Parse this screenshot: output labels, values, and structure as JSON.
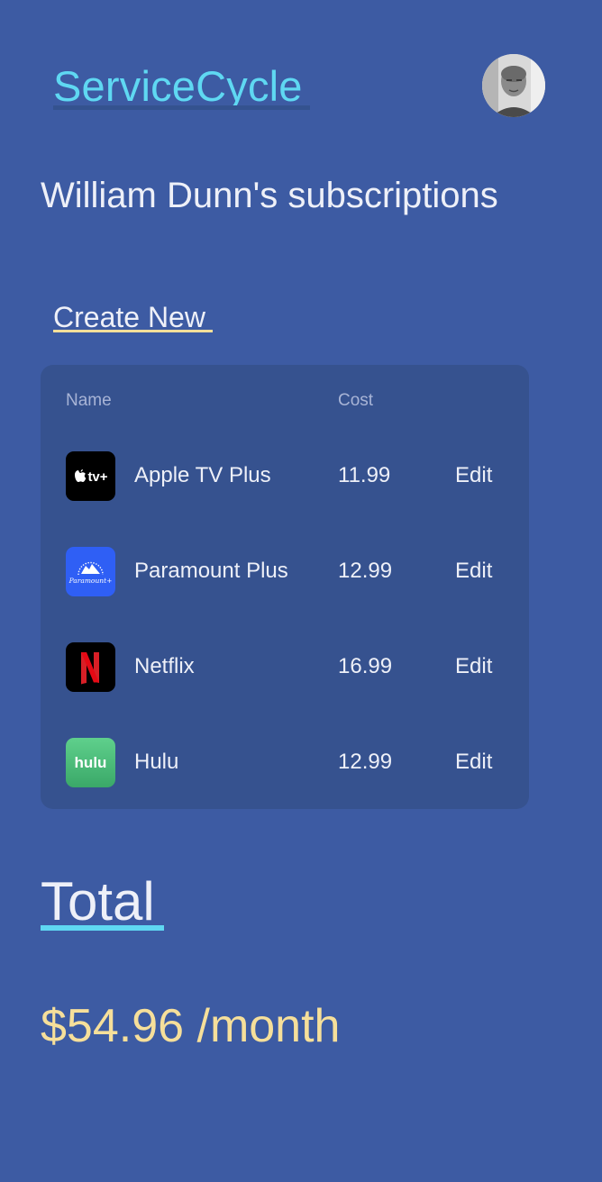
{
  "app": {
    "brand": "ServiceCycle",
    "brand_color": "#5fd8f2"
  },
  "header": {
    "avatar_icon": "user-avatar"
  },
  "page": {
    "title": "William Dunn's subscriptions",
    "create_new_label": "Create New"
  },
  "table": {
    "headers": {
      "name": "Name",
      "cost": "Cost"
    },
    "rows": [
      {
        "name": "Apple TV Plus",
        "cost": "11.99",
        "action": "Edit",
        "logo": "appletv-plus-logo",
        "logo_text": "tv+"
      },
      {
        "name": "Paramount Plus",
        "cost": "12.99",
        "action": "Edit",
        "logo": "paramount-plus-logo",
        "logo_text": "Paramount+"
      },
      {
        "name": "Netflix",
        "cost": "16.99",
        "action": "Edit",
        "logo": "netflix-logo",
        "logo_text": "N"
      },
      {
        "name": "Hulu",
        "cost": "12.99",
        "action": "Edit",
        "logo": "hulu-logo",
        "logo_text": "hulu"
      }
    ]
  },
  "summary": {
    "total_label": "Total",
    "total_value": "$54.96 /month",
    "accent_color": "#f6df9a"
  },
  "colors": {
    "background": "#3d5ba3",
    "card": "#36528f"
  }
}
